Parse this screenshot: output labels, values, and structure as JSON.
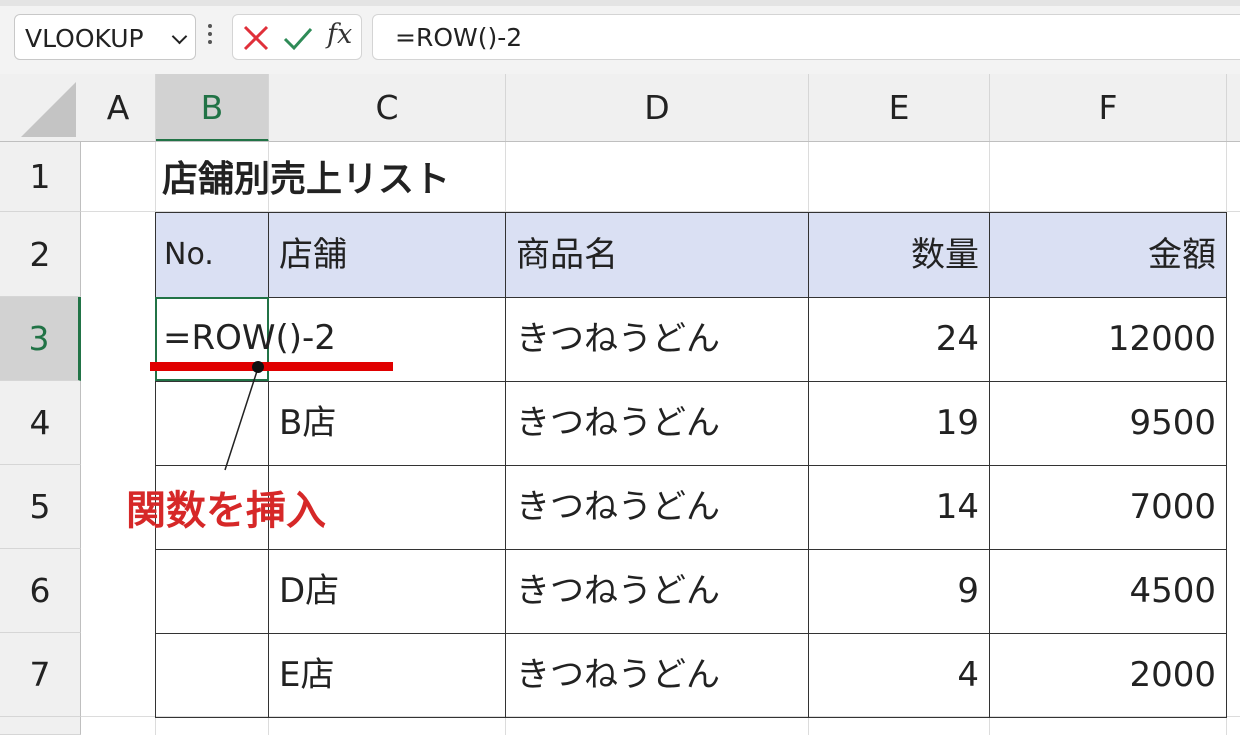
{
  "formula_bar": {
    "name_box": "VLOOKUP",
    "cancel_icon": "cross-icon",
    "enter_icon": "check-icon",
    "fx_label": "fx",
    "formula": "=ROW()-2",
    "colors": {
      "cancel": "#e0303a",
      "enter": "#2e8b57"
    }
  },
  "columns": [
    "A",
    "B",
    "C",
    "D",
    "E",
    "F"
  ],
  "selected_column": "B",
  "rows": [
    "1",
    "2",
    "3",
    "4",
    "5",
    "6",
    "7"
  ],
  "selected_row": "3",
  "sheet": {
    "title": "店舗別売上リスト",
    "headers": {
      "no": "No.",
      "store": "店舗",
      "product": "商品名",
      "qty": "数量",
      "amount": "金額"
    },
    "data": [
      {
        "no": "=ROW()-2",
        "store": "",
        "product": "きつねうどん",
        "qty": "24",
        "amount": "12000"
      },
      {
        "no": "",
        "store": "B店",
        "product": "きつねうどん",
        "qty": "19",
        "amount": "9500"
      },
      {
        "no": "",
        "store": "",
        "product": "きつねうどん",
        "qty": "14",
        "amount": "7000"
      },
      {
        "no": "",
        "store": "D店",
        "product": "きつねうどん",
        "qty": "9",
        "amount": "4500"
      },
      {
        "no": "",
        "store": "E店",
        "product": "きつねうどん",
        "qty": "4",
        "amount": "2000"
      }
    ]
  },
  "annotation": {
    "text": "関数を挿入",
    "color": "#d62828"
  },
  "theme": {
    "selection": "#217346",
    "header_fill": "#dae0f3"
  }
}
